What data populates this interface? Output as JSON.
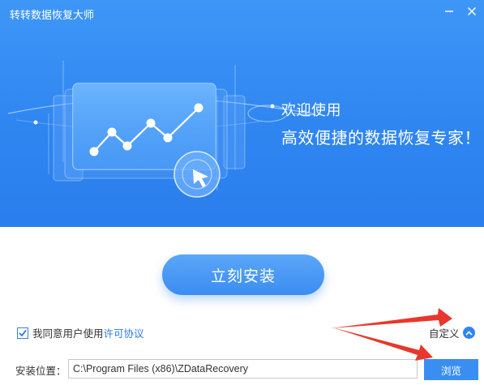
{
  "window": {
    "title": "转转数据恢复大师",
    "minimize_glyph": "—",
    "close_glyph": "✕"
  },
  "banner": {
    "welcome": "欢迎使用",
    "slogan": "高效便捷的数据恢复专家！"
  },
  "install_button": {
    "label": "立刻安装"
  },
  "agreement": {
    "checked": true,
    "prefix": "我同意用户使用",
    "link": "许可协议"
  },
  "custom": {
    "label": "自定义",
    "icon": "chevron-up-icon"
  },
  "path": {
    "label": "安装位置：",
    "value": "C:\\Program Files (x86)\\ZDataRecovery"
  },
  "browse_button": {
    "label": "浏览"
  },
  "colors": {
    "banner": "#2f86f1",
    "accent": "#3a8ef2",
    "link": "#2a78e4",
    "annotation": "#e8372c"
  }
}
